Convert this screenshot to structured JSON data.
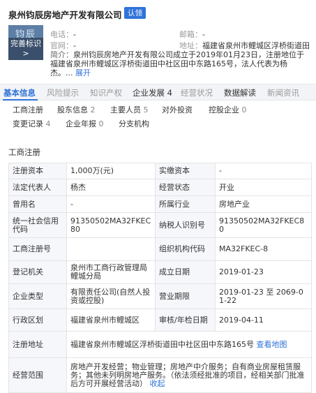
{
  "company": {
    "name": "泉州钧辰房地产开发有限公司",
    "claim_label": "认领",
    "logo_text_top": "钧辰",
    "logo_text_bottom": "完善标识 >"
  },
  "contact": {
    "phone_label": "电话：",
    "phone_value": "-",
    "email_label": "邮箱：",
    "email_value": "-",
    "website_label": "官网：",
    "website_value": "-",
    "address_label": "地址：",
    "address_value": "福建省泉州市鲤城区浮桥街道田",
    "intro_label": "简介：",
    "intro_value": "泉州钧辰房地产开发有限公司成立于2019年01月23日，注册地位于福建省泉州市鲤城区浮桥街道田中社区田中东路165号，法人代表为杨杰。...",
    "expand_label": "展开"
  },
  "tabs": [
    {
      "label": "基本信息"
    },
    {
      "label": "风险提示"
    },
    {
      "label": "知识产权"
    },
    {
      "label": "企业发展 4"
    },
    {
      "label": "经营状况"
    },
    {
      "label": "数据解读"
    },
    {
      "label": "新闻资讯"
    }
  ],
  "subtabs": [
    {
      "label": "工商注册",
      "count": ""
    },
    {
      "label": "股东信息",
      "count": "2"
    },
    {
      "label": "主要人员",
      "count": "5"
    },
    {
      "label": "对外投资",
      "count": ""
    },
    {
      "label": "控股企业",
      "count": "0"
    },
    {
      "label": "变更记录",
      "count": "4"
    },
    {
      "label": "企业年报",
      "count": "0"
    },
    {
      "label": "分支机构",
      "count": ""
    }
  ],
  "section_title": "工商注册",
  "registration": {
    "reg_capital_label": "注册资本",
    "reg_capital": "1,000万(元)",
    "paid_capital_label": "实缴资本",
    "paid_capital": "-",
    "legal_rep_label": "法定代表人",
    "legal_rep": "杨杰",
    "status_label": "经营状态",
    "status": "开业",
    "former_name_label": "曾用名",
    "former_name": "-",
    "industry_label": "所属行业",
    "industry": "房地产业",
    "credit_code_label": "统一社会信用代码",
    "credit_code": "91350502MA32FKEC80",
    "taxpayer_id_label": "纳税人识别号",
    "taxpayer_id": "91350502MA32FKEC80",
    "reg_no_label": "工商注册号",
    "reg_no": "",
    "org_code_label": "组织机构代码",
    "org_code": "MA32FKEC-8",
    "authority_label": "登记机关",
    "authority": "泉州市工商行政管理局鲤城分局",
    "founded_label": "成立日期",
    "founded": "2019-01-23",
    "type_label": "企业类型",
    "type": "有限责任公司(自然人投资或控股)",
    "term_label": "营业期限",
    "term": "2019-01-23 至 2069-01-22",
    "region_label": "行政区划",
    "region": "福建省泉州市鲤城区",
    "review_date_label": "审核/年检日期",
    "review_date": "2019-04-11",
    "address_label": "注册地址",
    "address": "福建省泉州市鲤城区浮桥街道田中社区田中东路165号",
    "map_link": "查看地图",
    "scope_label": "经营范围",
    "scope": "房地产开发经营；物业管理；房地产中介服务；自有商业房屋租赁服务；其他未列明房地产服务。（依法须经批准的项目，经相关部门批准后方可开展经营活动）",
    "collapse_link": "收起"
  }
}
